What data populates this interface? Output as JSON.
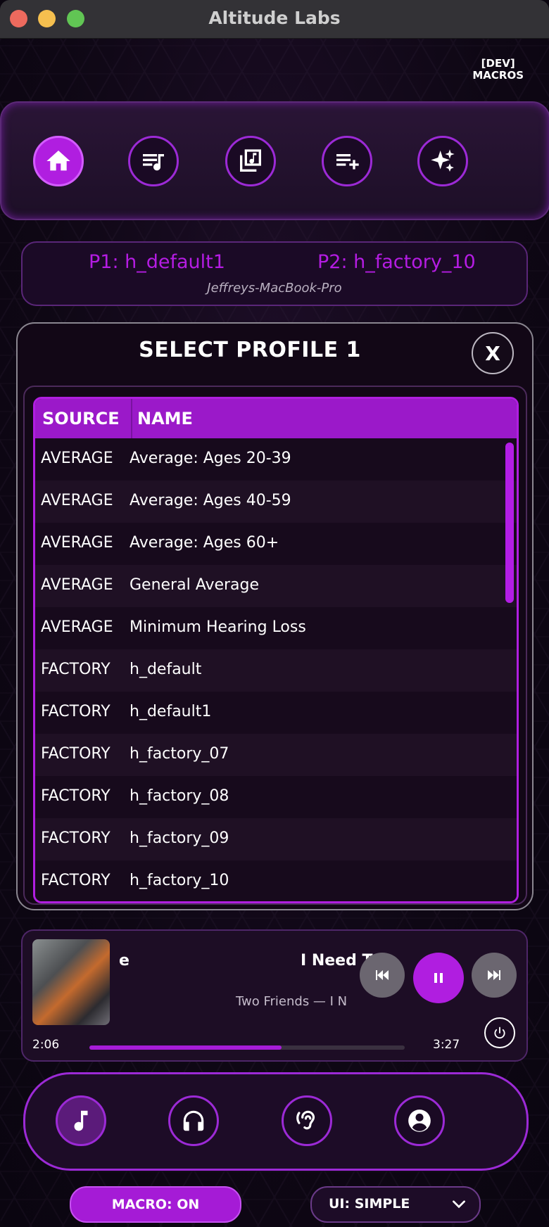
{
  "window": {
    "title": "Altitude Labs"
  },
  "dev_macros": {
    "line1": "[DEV]",
    "line2": "MACROS"
  },
  "top_nav": {
    "items": [
      "home-icon",
      "playlist-music-icon",
      "library-music-icon",
      "playlist-add-icon",
      "sparkles-icon"
    ],
    "active_index": 0
  },
  "profiles": {
    "p1": "P1: h_default1",
    "p2": "P2: h_factory_10",
    "host": "Jeffreys-MacBook-Pro"
  },
  "dialog": {
    "title": "SELECT PROFILE 1",
    "close_label": "X",
    "columns": {
      "source": "SOURCE",
      "name": "NAME"
    },
    "rows": [
      {
        "source": "AVERAGE",
        "name": "Average: Ages 20-39"
      },
      {
        "source": "AVERAGE",
        "name": "Average: Ages 40-59"
      },
      {
        "source": "AVERAGE",
        "name": "Average: Ages 60+"
      },
      {
        "source": "AVERAGE",
        "name": "General Average"
      },
      {
        "source": "AVERAGE",
        "name": "Minimum Hearing Loss"
      },
      {
        "source": "FACTORY",
        "name": "h_default"
      },
      {
        "source": "FACTORY",
        "name": "h_default1"
      },
      {
        "source": "FACTORY",
        "name": "h_factory_07"
      },
      {
        "source": "FACTORY",
        "name": "h_factory_08"
      },
      {
        "source": "FACTORY",
        "name": "h_factory_09"
      },
      {
        "source": "FACTORY",
        "name": "h_factory_10"
      }
    ]
  },
  "player": {
    "title_fragment": "e",
    "title": "I Need T",
    "artist": "Two Friends — I N",
    "elapsed": "2:06",
    "duration": "3:27",
    "progress_fraction": 0.61
  },
  "bottom_nav": {
    "items": [
      "music-note-icon",
      "headphones-icon",
      "hearing-icon",
      "account-icon"
    ],
    "active_index": 0
  },
  "macro": {
    "label": "MACRO: ON"
  },
  "ui_select": {
    "value": "UI: SIMPLE"
  },
  "colors": {
    "accent": "#b01ee0",
    "accent_border": "#9c2ad6",
    "background": "#0e0714"
  }
}
